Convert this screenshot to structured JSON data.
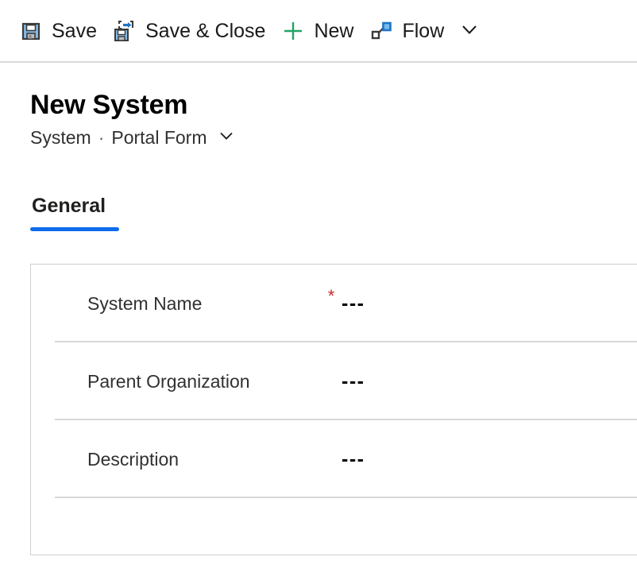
{
  "commandbar": {
    "buttons": [
      {
        "id": "save",
        "label": "Save",
        "icon": "save-floppy-icon"
      },
      {
        "id": "save-close",
        "label": "Save & Close",
        "icon": "save-and-close-icon"
      },
      {
        "id": "new",
        "label": "New",
        "icon": "plus-icon"
      },
      {
        "id": "flow",
        "label": "Flow",
        "icon": "flow-icon"
      }
    ],
    "overflow_icon": "chevron-down-icon"
  },
  "header": {
    "title": "New System",
    "entity": "System",
    "separator": "·",
    "form_name": "Portal Form",
    "form_selector_icon": "chevron-down-icon"
  },
  "tabs": [
    {
      "id": "general",
      "label": "General",
      "selected": true
    }
  ],
  "form": {
    "fields": [
      {
        "id": "system-name",
        "label": "System Name",
        "required": true,
        "required_marker": "*",
        "value": "---"
      },
      {
        "id": "parent-organization",
        "label": "Parent Organization",
        "required": false,
        "required_marker": "",
        "value": "---"
      },
      {
        "id": "description",
        "label": "Description",
        "required": false,
        "required_marker": "",
        "value": "---"
      }
    ]
  },
  "colors": {
    "accent": "#0f6cec",
    "required": "#c8292b",
    "new_green": "#21a366",
    "icon_blue": "#1e74c6",
    "floppy_blue": "#86bce8",
    "icon_dark": "#3b3a39",
    "border": "#d2d0ce",
    "divider": "#d9d9d9"
  }
}
